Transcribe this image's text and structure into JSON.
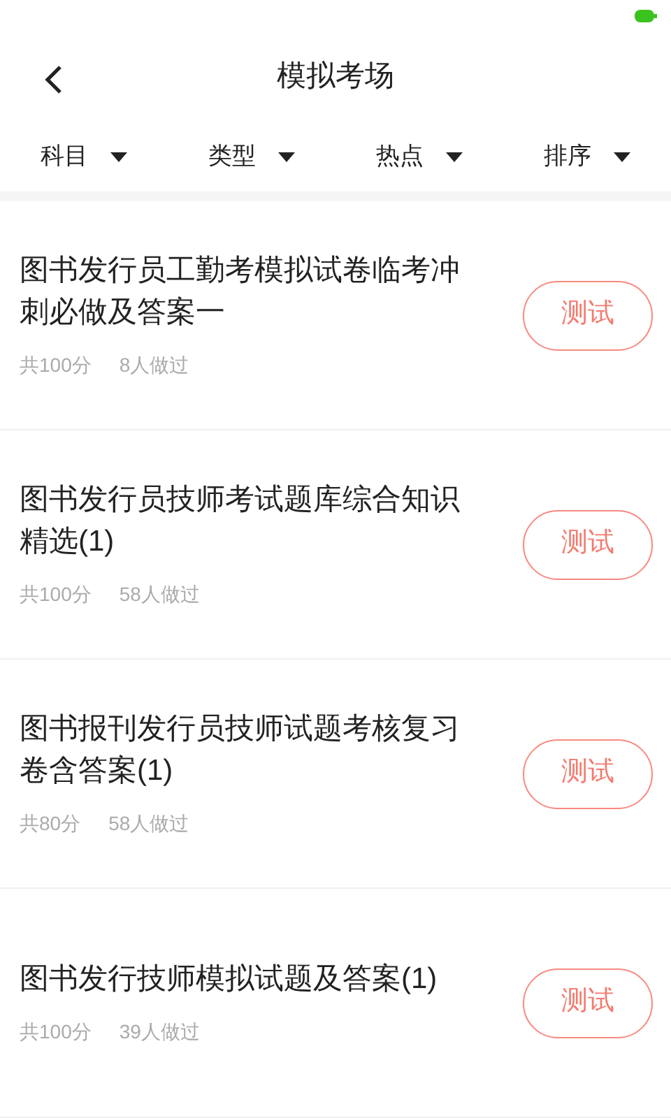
{
  "header": {
    "title": "模拟考场"
  },
  "filters": [
    {
      "label": "科目"
    },
    {
      "label": "类型"
    },
    {
      "label": "热点"
    },
    {
      "label": "排序"
    }
  ],
  "papers": [
    {
      "title": "图书发行员工勤考模拟试卷临考冲刺必做及答案一",
      "score": "共100分",
      "taken": "8人做过",
      "button": "测试"
    },
    {
      "title": "图书发行员技师考试题库综合知识精选(1)",
      "score": "共100分",
      "taken": "58人做过",
      "button": "测试"
    },
    {
      "title": "图书报刊发行员技师试题考核复习卷含答案(1)",
      "score": "共80分",
      "taken": "58人做过",
      "button": "测试"
    },
    {
      "title": "图书发行技师模拟试题及答案(1)",
      "score": "共100分",
      "taken": "39人做过",
      "button": "测试"
    }
  ]
}
